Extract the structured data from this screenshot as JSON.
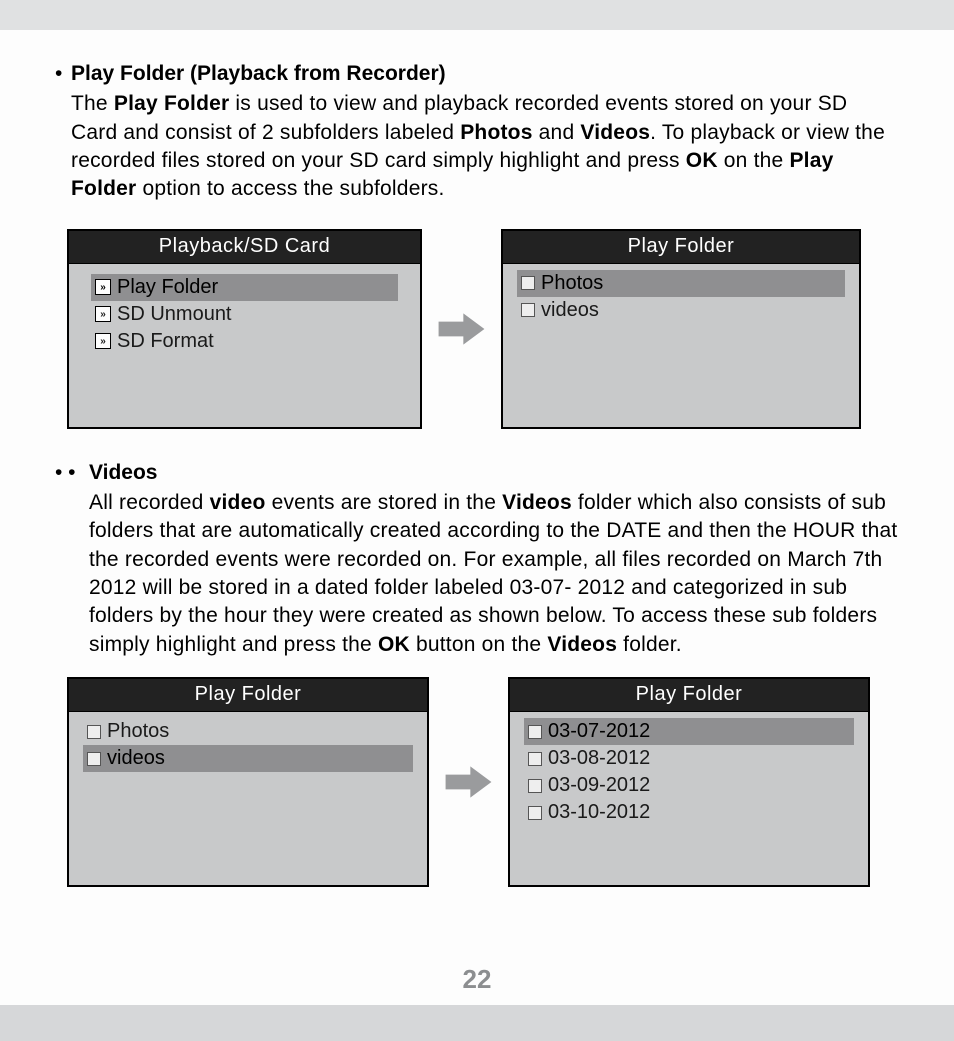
{
  "section1": {
    "bullet": "•",
    "heading": "Play Folder (Playback from Recorder)",
    "body": "The <b>Play Folder</b> is used to view and playback recorded events stored on your SD Card and consist of 2 subfolders labeled <b>Photos</b> and <b>Videos</b>. To playback or view the recorded files stored on your SD card simply highlight and press <b>OK</b> on the <b>Play Folder</b> option to access the subfolders."
  },
  "figure1": {
    "left": {
      "title": "Playback/SD Card",
      "items": [
        {
          "label": "Play Folder",
          "highlight": true
        },
        {
          "label": "SD Unmount",
          "highlight": false
        },
        {
          "label": "SD Format",
          "highlight": false
        }
      ]
    },
    "right": {
      "title": "Play Folder",
      "items": [
        {
          "label": "Photos",
          "highlight": true
        },
        {
          "label": "videos",
          "highlight": false
        }
      ]
    }
  },
  "section2": {
    "bullet": "•  •",
    "heading": "Videos",
    "body": "All recorded <b>video</b> events are stored in the <b>Videos</b> folder which also consists of sub folders that are automatically created according to the DATE and then the HOUR that the recorded events were recorded on. For example, all files recorded on March 7th  2012 will be stored in a dated folder labeled 03-07- 2012 and categorized in sub folders by the hour they were created as shown below. To access these sub folders simply highlight and press the <b>OK</b> button on the <b>Videos</b> folder."
  },
  "figure2": {
    "left": {
      "title": "Play Folder",
      "items": [
        {
          "label": "Photos",
          "highlight": false
        },
        {
          "label": "videos",
          "highlight": true
        }
      ]
    },
    "right": {
      "title": "Play Folder",
      "items": [
        {
          "label": "03-07-2012",
          "highlight": true
        },
        {
          "label": "03-08-2012",
          "highlight": false
        },
        {
          "label": "03-09-2012",
          "highlight": false
        },
        {
          "label": "03-10-2012",
          "highlight": false
        }
      ]
    }
  },
  "page_number": "22"
}
